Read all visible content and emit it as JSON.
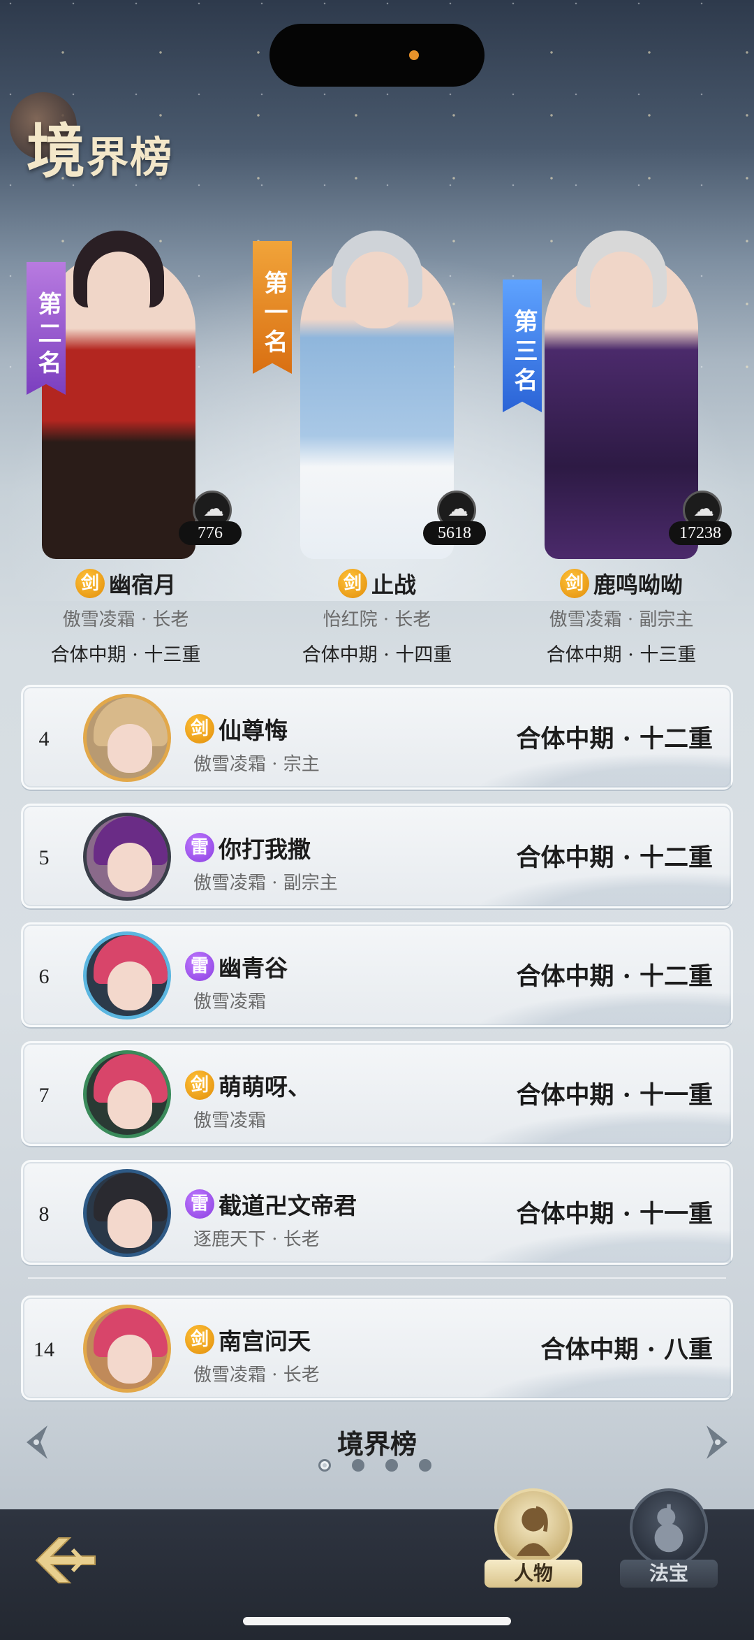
{
  "page": {
    "title_big": "境",
    "title_rest": "界榜"
  },
  "top3": [
    {
      "banner": "第二名",
      "fans": "776",
      "element": "剑",
      "element_kind": "sword",
      "name": "幽宿月",
      "sect": "傲雪凌霜 · 长老",
      "level": "合体中期 · 十三重",
      "hair_color": "#2a1f24",
      "outfit_color": "#b32620"
    },
    {
      "banner": "第一名",
      "fans": "5618",
      "element": "剑",
      "element_kind": "sword",
      "name": "止战",
      "sect": "怡红院 · 长老",
      "level": "合体中期 · 十四重",
      "hair_color": "#cfd3d8",
      "outfit_color": "#8fb6dc"
    },
    {
      "banner": "第三名",
      "fans": "17238",
      "element": "剑",
      "element_kind": "sword",
      "name": "鹿鸣呦呦",
      "sect": "傲雪凌霜 · 副宗主",
      "level": "合体中期 · 十三重",
      "hair_color": "#d8d8d8",
      "outfit_color": "#4b2a6b"
    }
  ],
  "list": [
    {
      "rank": "4",
      "element": "剑",
      "element_kind": "sword",
      "name": "仙尊悔",
      "sect": "傲雪凌霜 · 宗主",
      "level": "合体中期 · 十二重",
      "hair_color": "#d8b98a",
      "ring_color": "#e2a84a"
    },
    {
      "rank": "5",
      "element": "雷",
      "element_kind": "thunder",
      "name": "你打我撒",
      "sect": "傲雪凌霜 · 副宗主",
      "level": "合体中期 · 十二重",
      "hair_color": "#6a2c86",
      "ring_color": "#2a2f3a"
    },
    {
      "rank": "6",
      "element": "雷",
      "element_kind": "thunder",
      "name": "幽青谷",
      "sect": "傲雪凌霜",
      "level": "合体中期 · 十二重",
      "hair_color": "#d8456a",
      "ring_color": "#5bb6e0"
    },
    {
      "rank": "7",
      "element": "剑",
      "element_kind": "sword",
      "name": "萌萌呀、",
      "sect": "傲雪凌霜",
      "level": "合体中期 · 十一重",
      "hair_color": "#d8456a",
      "ring_color": "#3a8a5a"
    },
    {
      "rank": "8",
      "element": "雷",
      "element_kind": "thunder",
      "name": "截道卍文帝君",
      "sect": "逐鹿天下 · 长老",
      "level": "合体中期 · 十一重",
      "hair_color": "#2a2a30",
      "ring_color": "#2e5a86"
    }
  ],
  "self_row": {
    "rank": "14",
    "element": "剑",
    "element_kind": "sword",
    "name": "南宫问天",
    "sect": "傲雪凌霜 · 长老",
    "level": "合体中期 · 八重",
    "hair_color": "#d8456a",
    "ring_color": "#e2a84a"
  },
  "footer": {
    "title": "境界榜",
    "page_count": 4,
    "active_page": 1
  },
  "tabs": {
    "person": "人物",
    "treasure": "法宝"
  }
}
